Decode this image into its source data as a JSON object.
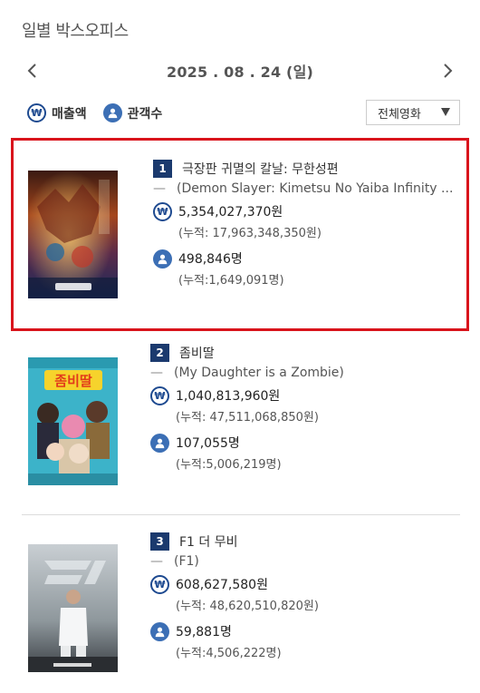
{
  "header": {
    "title": "일별 박스오피스"
  },
  "date_nav": {
    "date": "2025 . 08 . 24  (일)"
  },
  "legend": {
    "revenue_label": "매출액",
    "audience_label": "관객수",
    "won_symbol": "₩"
  },
  "filter": {
    "selected": "전체영화"
  },
  "movies": [
    {
      "rank": "1",
      "title": "극장판 귀멸의 칼날: 무한성편",
      "dash": "—",
      "original_title": "(Demon Slayer: Kimetsu No Yaiba Infinity ...",
      "revenue": "5,354,027,370원",
      "revenue_cum": "(누적: 17,963,348,350원)",
      "audience": "498,846명",
      "audience_cum": "(누적:1,649,091명)",
      "poster_text": "귀멸의 칼날 무한성편",
      "highlighted": true
    },
    {
      "rank": "2",
      "title": "좀비딸",
      "dash": "—",
      "original_title": "(My Daughter is a Zombie)",
      "revenue": "1,040,813,960원",
      "revenue_cum": "(누적: 47,511,068,850원)",
      "audience": "107,055명",
      "audience_cum": "(누적:5,006,219명)",
      "poster_text": "좀비딸",
      "highlighted": false
    },
    {
      "rank": "3",
      "title": "F1 더 무비",
      "dash": "—",
      "original_title": "(F1)",
      "revenue": "608,627,580원",
      "revenue_cum": "(누적: 48,620,510,820원)",
      "audience": "59,881명",
      "audience_cum": "(누적:4,506,222명)",
      "poster_text": "F1",
      "highlighted": false
    }
  ],
  "colors": {
    "highlight": "#d9141c",
    "rank_badge": "#1b3a6e",
    "won_icon": "#1e4a90",
    "person_icon": "#3c6fb5"
  }
}
